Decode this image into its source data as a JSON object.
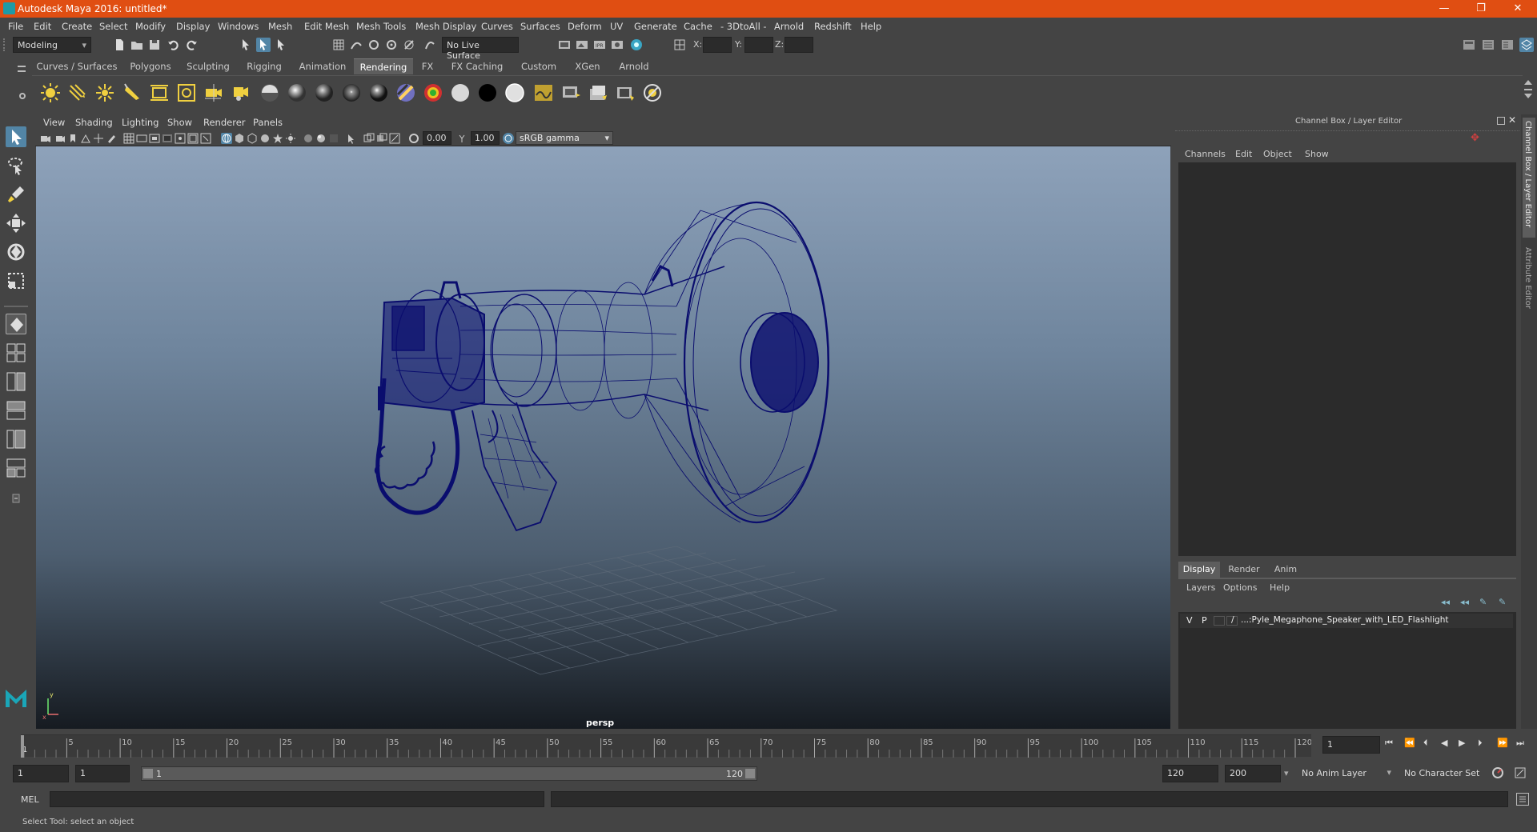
{
  "window": {
    "title": "Autodesk Maya 2016: untitled*",
    "controls": [
      "—",
      "❐",
      "✕"
    ]
  },
  "menubar": [
    "File",
    "Edit",
    "Create",
    "Select",
    "Modify",
    "Display",
    "Windows",
    "Mesh",
    "Edit Mesh",
    "Mesh Tools",
    "Mesh Display",
    "Curves",
    "Surfaces",
    "Deform",
    "UV",
    "Generate",
    "Cache",
    "- 3DtoAll -",
    "Arnold",
    "Redshift",
    "Help"
  ],
  "statusline": {
    "mode": "Modeling",
    "live_surface": "No Live Surface",
    "x_label": "X:",
    "y_label": "Y:",
    "z_label": "Z:"
  },
  "shelf": {
    "tabs": [
      "Curves / Surfaces",
      "Polygons",
      "Sculpting",
      "Rigging",
      "Animation",
      "Rendering",
      "FX",
      "FX Caching",
      "Custom",
      "XGen",
      "Arnold"
    ],
    "active_tab": "Rendering"
  },
  "viewport": {
    "menu": [
      "View",
      "Shading",
      "Lighting",
      "Show",
      "Renderer",
      "Panels"
    ],
    "exposure": "0.00",
    "gamma": "1.00",
    "color_space": "sRGB gamma",
    "camera_label": "persp"
  },
  "channel_box": {
    "title": "Channel Box / Layer Editor",
    "menu": [
      "Channels",
      "Edit",
      "Object",
      "Show"
    ]
  },
  "layer_editor": {
    "tabs": [
      "Display",
      "Render",
      "Anim"
    ],
    "active_tab": "Display",
    "menu": [
      "Layers",
      "Options",
      "Help"
    ],
    "layer": {
      "v": "V",
      "p": "P",
      "name": "...:Pyle_Megaphone_Speaker_with_LED_Flashlight"
    }
  },
  "side_tabs": [
    "Channel Box / Layer Editor",
    "Attribute Editor"
  ],
  "timeline": {
    "ticks": [
      "5",
      "10",
      "15",
      "20",
      "25",
      "30",
      "35",
      "40",
      "45",
      "50",
      "55",
      "60",
      "65",
      "70",
      "75",
      "80",
      "85",
      "90",
      "95",
      "100",
      "105",
      "110",
      "115",
      "120"
    ],
    "start_marker": "1",
    "current_frame": "1"
  },
  "range": {
    "start_time": "1",
    "playback_start": "1",
    "slider_start": "1",
    "slider_end": "120",
    "playback_end": "120",
    "end_time": "200",
    "anim_layer": "No Anim Layer",
    "character_set": "No Character Set"
  },
  "command_line": {
    "label": "MEL"
  },
  "help_line": {
    "text": "Select Tool: select an object"
  },
  "colors": {
    "titlebar": "#e04e12",
    "accent": "#5285a6",
    "wireframe": "#0a0d6e"
  }
}
